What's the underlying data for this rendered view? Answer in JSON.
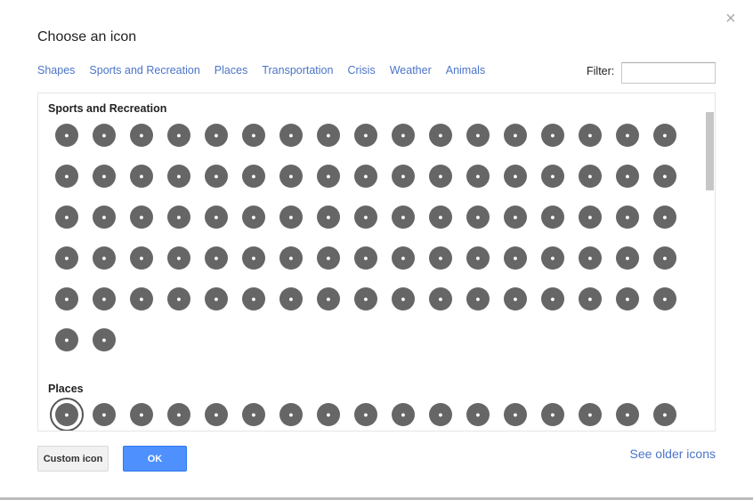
{
  "dialog": {
    "title": "Choose an icon",
    "close": "×",
    "filter_label": "Filter:",
    "filter_value": "",
    "tabs": [
      "Shapes",
      "Sports and Recreation",
      "Places",
      "Transportation",
      "Crisis",
      "Weather",
      "Animals"
    ],
    "custom_label": "Custom icon",
    "ok_label": "OK",
    "older_label": "See older icons"
  },
  "sections": [
    {
      "title": "Sports and Recreation",
      "icons": [
        "baseball",
        "basketball",
        "football",
        "soccer",
        "rugby",
        "volleyball",
        "golfer",
        "golf-flag",
        "tennis",
        "hockey",
        "badminton",
        "racquet",
        "ping-pong",
        "boxing",
        "martial-arts",
        "fencing",
        "weightlifting",
        "racing-flag",
        "rodeo",
        "horse",
        "bowling",
        "billiards",
        "cricket",
        "archery",
        "running",
        "hiking",
        "cycling",
        "gymnastics",
        "climbing",
        "climbing-wall",
        "frisbee",
        "skating",
        "parachute",
        "hang-glider",
        "ice-hockey",
        "ice-skating",
        "skiing",
        "cross-country-ski",
        "snow-shoe",
        "snowboard",
        "sledding",
        "hiking-trail",
        "snowmobile",
        "kayak",
        "rowing",
        "sailing",
        "jetski",
        "surfing",
        "water-ski",
        "windsurfing",
        "swimming",
        "snorkel",
        "diving",
        "fishing",
        "sunbathing",
        "beach",
        "water-slide",
        "picnic",
        "tree",
        "park",
        "palm-tree",
        "mountain",
        "campfire",
        "hot-spring",
        "waterfall",
        "star",
        "hiker",
        "walking",
        "family",
        "binoculars-man",
        "hunting",
        "deer",
        "viewpoint",
        "mining",
        "telescope",
        "binoculars",
        "tent",
        "guitar",
        "bonfire",
        "grill",
        "axe",
        "rv",
        "atv",
        "camper",
        "trailer",
        "theater",
        "fishing-spot"
      ],
      "selected": -1
    },
    {
      "title": "Places",
      "icons": [
        "restaurant",
        "fast-food",
        "burger",
        "hot-dog",
        "pizza",
        "noodles",
        "dim-sum",
        "steak",
        "chicken",
        "fish",
        "ice-cream",
        "cocktail",
        "drink",
        "beer",
        "wine",
        "coffee",
        "tea"
      ],
      "selected": 0
    }
  ]
}
